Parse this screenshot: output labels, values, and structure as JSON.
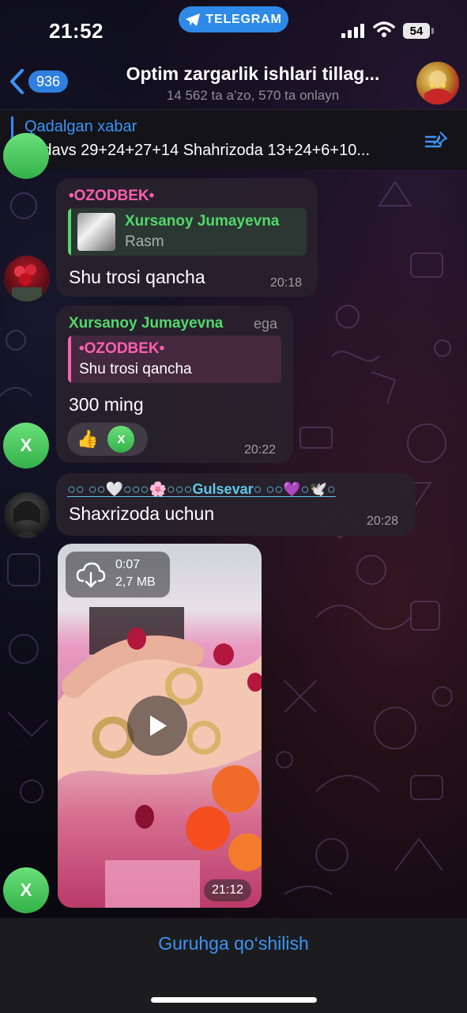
{
  "status_bar": {
    "time": "21:52",
    "telegram_pill": "TELEGRAM",
    "battery": "54"
  },
  "header": {
    "back_count": "936",
    "title": "Optim zargarlik ishlari tillag...",
    "subtitle": "14 562 ta a’zo, 570 ta onlayn"
  },
  "pinned": {
    "label": "Qadalgan xabar",
    "text": "Firdavs 29+24+27+14 Shahrizoda 13+24+6+10..."
  },
  "messages": [
    {
      "sender": "•OZODBEK•",
      "reply_name": "Xursanoy Jumayevna",
      "reply_text": "Rasm",
      "text": "Shu trosi qancha",
      "time": "20:18"
    },
    {
      "sender": "Xursanoy Jumayevna",
      "role": "ega",
      "reply_name": "•OZODBEK•",
      "reply_text": "Shu trosi qancha",
      "text": "300 ming",
      "reaction_emoji": "👍",
      "reaction_avatar": "X",
      "time": "20:22"
    },
    {
      "sender": "○○ ○○🤍○○○🌸○○○Gulsevar○ ○○💜○🕊️○",
      "text": "Shaxrizoda uchun",
      "time": "20:28"
    },
    {
      "video_duration": "0:07",
      "video_size": "2,7 MB",
      "time": "21:12"
    }
  ],
  "avatars": {
    "x_letter": "X"
  },
  "footer": {
    "join_label": "Guruhga qo‘shilish"
  },
  "colors": {
    "accent": "#3a94f6",
    "ozodbek_pink": "#ff5fb0",
    "xursanoy_green": "#52d96a",
    "gulsevar_cyan": "#5ec8e8"
  }
}
